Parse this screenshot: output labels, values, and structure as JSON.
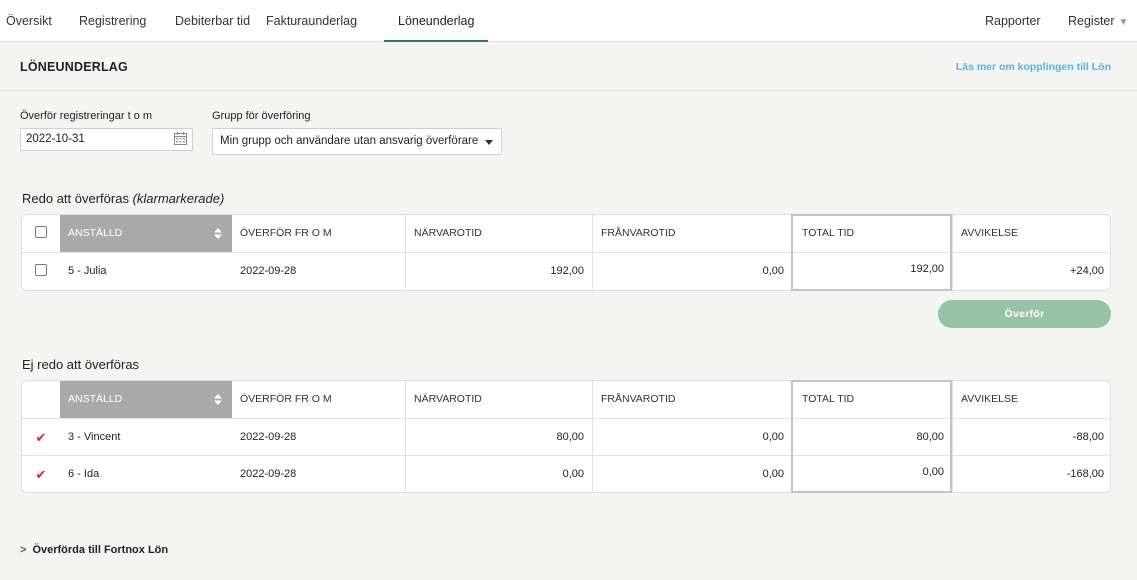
{
  "nav": {
    "tabs": [
      {
        "label": "Översikt"
      },
      {
        "label": "Registrering"
      },
      {
        "label": "Debiterbar tid"
      },
      {
        "label": "Fakturaunderlag"
      },
      {
        "label": "Löneunderlag"
      }
    ],
    "active_tab": "Löneunderlag",
    "reports_label": "Rapporter",
    "register_label": "Register"
  },
  "header": {
    "title": "LÖNEUNDERLAG",
    "info_link": "Läs mer om kopplingen till Lön"
  },
  "filters": {
    "date_label": "Överför registreringar t o m",
    "date_value": "2022-10-31",
    "group_label": "Grupp för överföring",
    "group_value": "Min grupp och användare utan ansvarig överförare"
  },
  "columns": {
    "employee": "ANSTÄLLD",
    "from": "ÖVERFÖR FR O M",
    "attendance": "NÄRVAROTID",
    "absence": "FRÅNVAROTID",
    "total": "TOTAL TID",
    "deviation": "AVVIKELSE"
  },
  "ready": {
    "heading": "Redo att överföras",
    "heading_note": "(klarmarkerade)",
    "rows": [
      {
        "employee": "5 - Julia",
        "from": "2022-09-28",
        "attendance": "192,00",
        "absence": "0,00",
        "total": "192,00",
        "deviation": "+24,00"
      }
    ],
    "transfer_button": "Överför"
  },
  "not_ready": {
    "heading": "Ej redo att överföras",
    "rows": [
      {
        "employee": "3 - Vincent",
        "from": "2022-09-28",
        "attendance": "80,00",
        "absence": "0,00",
        "total": "80,00",
        "deviation": "-88,00"
      },
      {
        "employee": "6 - Ida",
        "from": "2022-09-28",
        "attendance": "0,00",
        "absence": "0,00",
        "total": "0,00",
        "deviation": "-168,00"
      }
    ]
  },
  "footer": {
    "transferred_link": "Överförda till Fortnox Lön"
  },
  "colors": {
    "accent": "#2f7a4f",
    "link": "#58b4d6",
    "button": "#96c3a6",
    "check": "#dd2222"
  }
}
